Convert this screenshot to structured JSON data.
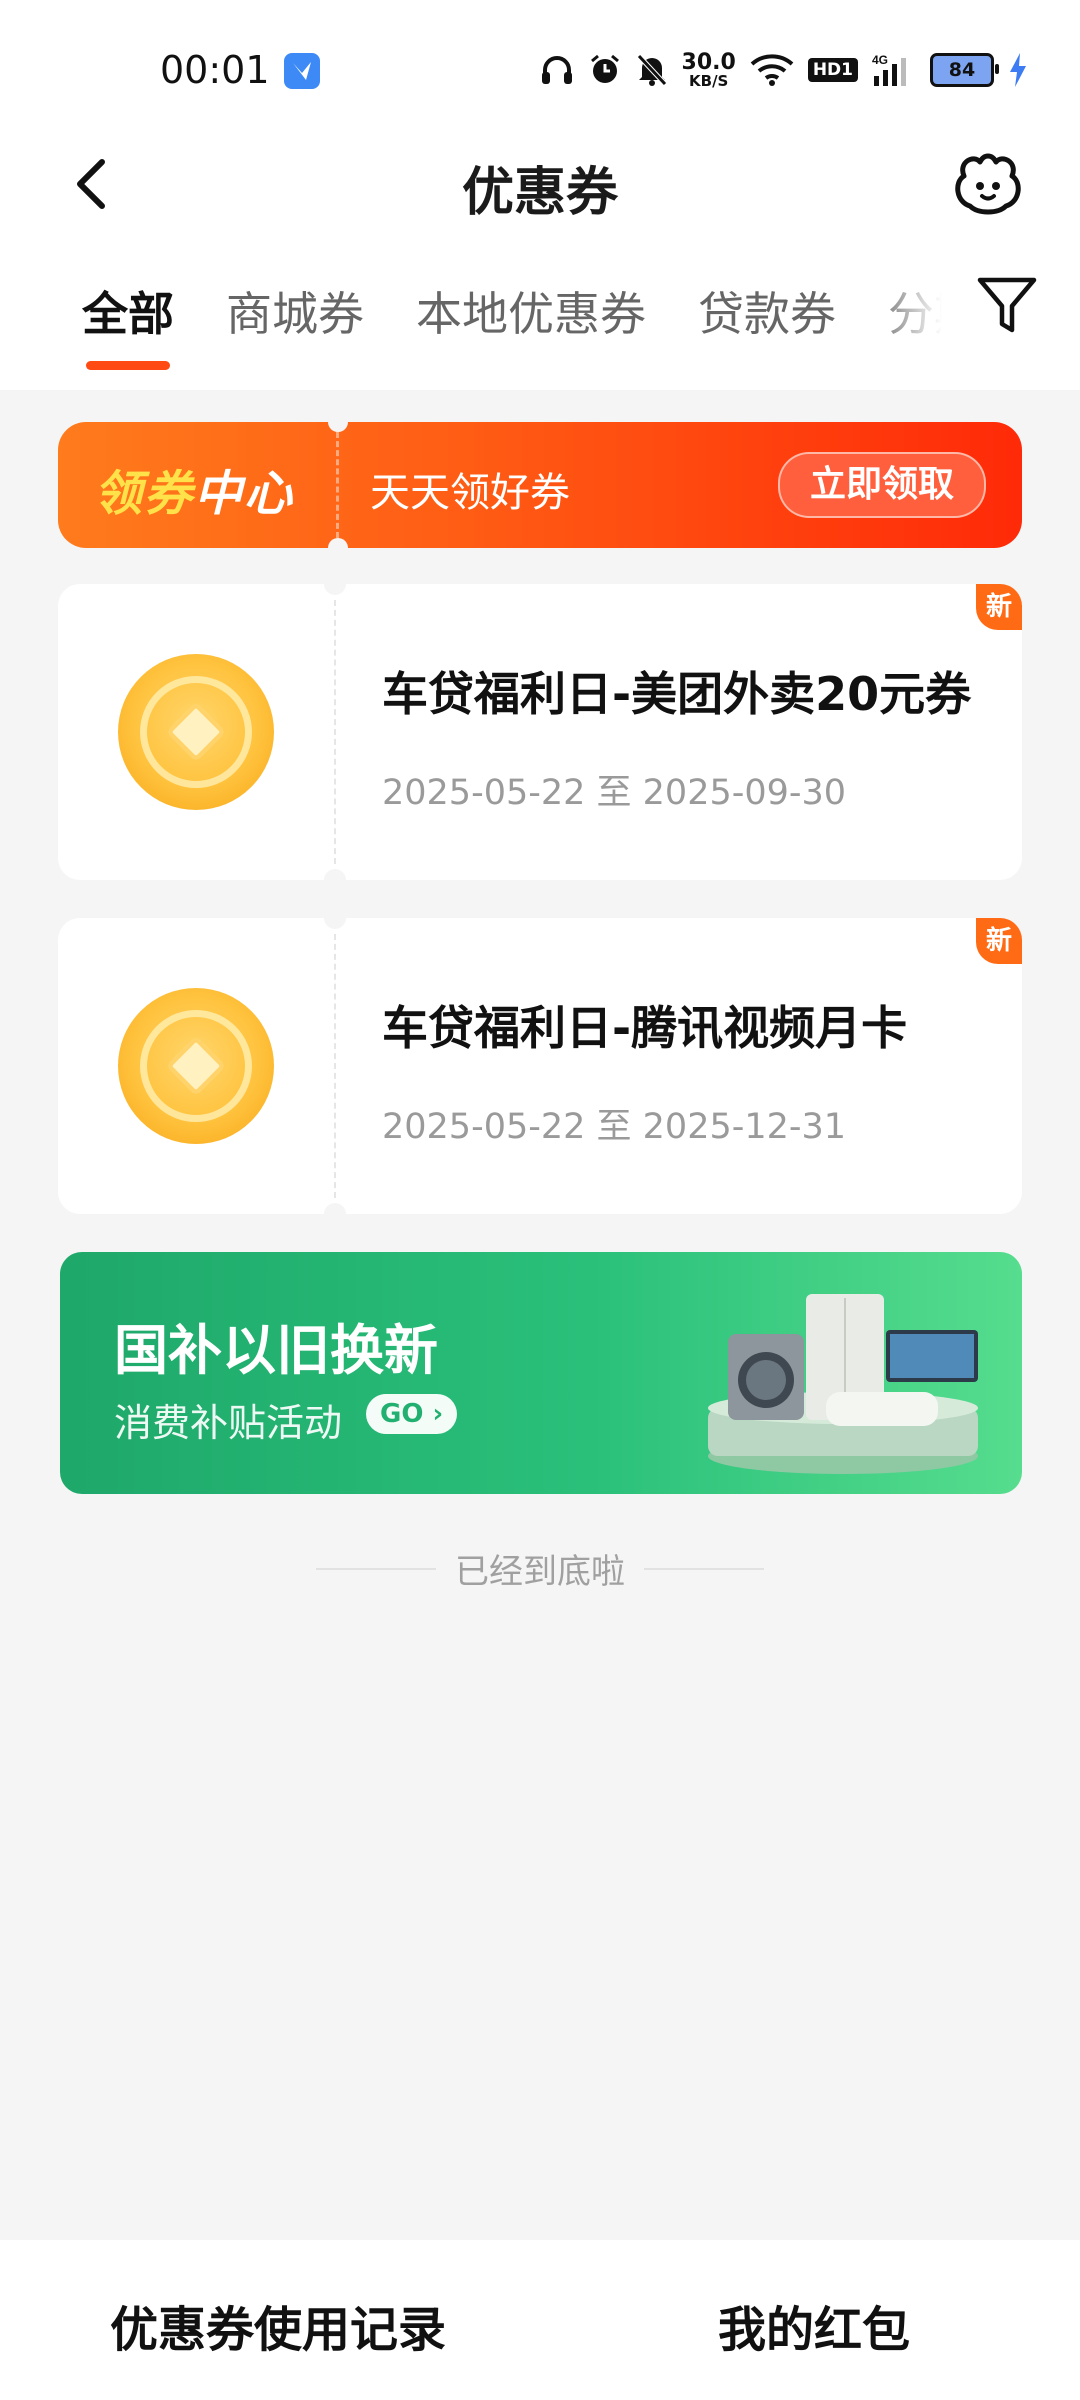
{
  "status_bar": {
    "time": "00:01",
    "net_speed": "30.0",
    "net_unit": "KB/S",
    "network_type": "4G",
    "hd_label": "HD1",
    "battery": "84",
    "icons": [
      "headphones-icon",
      "alarm-icon",
      "mute-icon",
      "wifi-icon",
      "signal-icon",
      "charging-icon"
    ]
  },
  "header": {
    "title": "优惠券",
    "icons": {
      "back": "back-arrow-icon",
      "service": "customer-service-icon",
      "filter": "filter-icon"
    }
  },
  "tabs": [
    "全部",
    "商城券",
    "本地优惠券",
    "贷款券",
    "分期"
  ],
  "active_tab": 0,
  "banner": {
    "label_part1": "领券",
    "label_part2": "中心",
    "subtitle": "天天领好券",
    "button": "立即领取"
  },
  "coupons": [
    {
      "title": "车贷福利日-美团外卖20元券",
      "date": "2025-05-22 至 2025-09-30",
      "badge": "新"
    },
    {
      "title": "车贷福利日-腾讯视频月卡",
      "date": "2025-05-22 至 2025-12-31",
      "badge": "新"
    }
  ],
  "promo": {
    "title": "国补以旧换新",
    "subtitle": "消费补贴活动",
    "go_label": "GO"
  },
  "end_hint": "已经到底啦",
  "bottom_bar": {
    "left_button": "优惠券使用记录",
    "right_button": "我的红包"
  },
  "colors": {
    "accent": "#ff4a14",
    "banner_start": "#ff7b1c",
    "banner_end": "#ff2a08",
    "coin": "#ffc23d",
    "promo_green": "#1ea86a"
  }
}
